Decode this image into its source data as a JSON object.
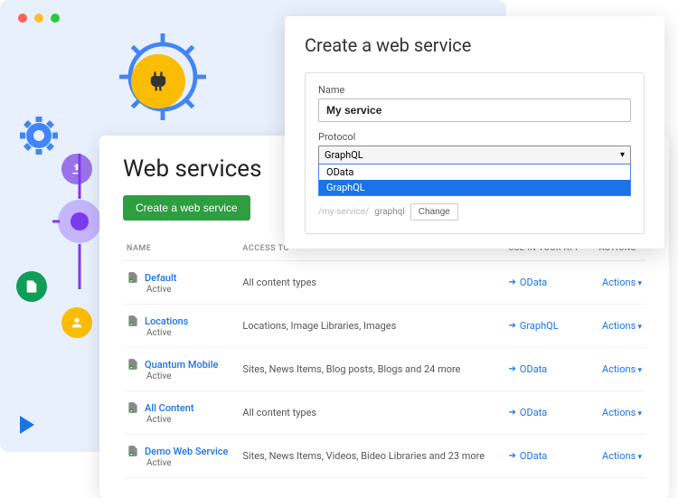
{
  "main": {
    "title": "Web services",
    "create_button": "Create a web service",
    "columns": {
      "name": "NAME",
      "access": "ACCESS TO",
      "use": "USE IN YOUR APP",
      "actions": "ACTIONS"
    },
    "actions_label": "Actions",
    "services": [
      {
        "name": "Default",
        "status": "Active",
        "access": "All content types",
        "use": "OData"
      },
      {
        "name": "Locations",
        "status": "Active",
        "access": "Locations, Image Libraries, Images",
        "use": "GraphQL"
      },
      {
        "name": "Quantum Mobile",
        "status": "Active",
        "access": "Sites, News Items, Blog posts, Blogs and 24 more",
        "use": "OData"
      },
      {
        "name": "All Content",
        "status": "Active",
        "access": "All content types",
        "use": "OData"
      },
      {
        "name": "Demo Web Service",
        "status": "Active",
        "access": "Sites, News Items, Videos, Bideo Libraries and 23 more",
        "use": "OData"
      }
    ]
  },
  "modal": {
    "title": "Create a web service",
    "name_label": "Name",
    "name_value": "My service",
    "protocol_label": "Protocol",
    "protocol_value": "GraphQL",
    "options": [
      "OData",
      "GraphQL"
    ],
    "url": {
      "prefix": "/my-service/",
      "suffix": "graphql"
    },
    "change_label": "Change"
  }
}
